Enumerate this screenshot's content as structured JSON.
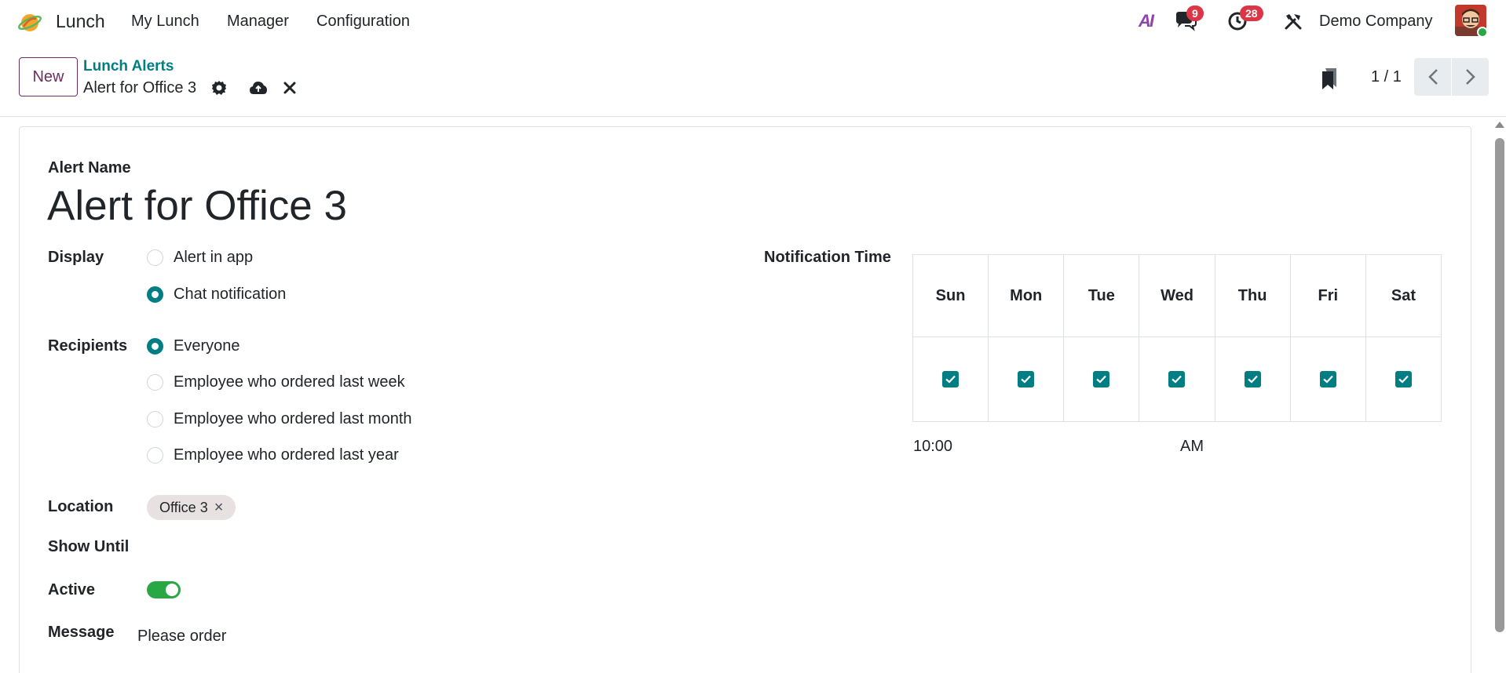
{
  "navbar": {
    "app_name": "Lunch",
    "menu": [
      "My Lunch",
      "Manager",
      "Configuration"
    ],
    "messages_count": "9",
    "activities_count": "28",
    "company": "Demo Company",
    "ai_label": "AI"
  },
  "control_panel": {
    "new_label": "New",
    "breadcrumb_parent": "Lunch Alerts",
    "breadcrumb_current": "Alert for Office 3",
    "pager": "1 / 1"
  },
  "form": {
    "name_label": "Alert Name",
    "name_value": "Alert for Office 3",
    "display_label": "Display",
    "display_options": [
      {
        "label": "Alert in app",
        "checked": false
      },
      {
        "label": "Chat notification",
        "checked": true
      }
    ],
    "recipients_label": "Recipients",
    "recipients_options": [
      {
        "label": "Everyone",
        "checked": true
      },
      {
        "label": "Employee who ordered last week",
        "checked": false
      },
      {
        "label": "Employee who ordered last month",
        "checked": false
      },
      {
        "label": "Employee who ordered last year",
        "checked": false
      }
    ],
    "location_label": "Location",
    "location_tag": "Office 3",
    "show_until_label": "Show Until",
    "active_label": "Active",
    "active": true,
    "message_label": "Message",
    "message_value": "Please order",
    "notification_time_label": "Notification Time",
    "days": [
      {
        "name": "Sun",
        "checked": true
      },
      {
        "name": "Mon",
        "checked": true
      },
      {
        "name": "Tue",
        "checked": true
      },
      {
        "name": "Wed",
        "checked": true
      },
      {
        "name": "Thu",
        "checked": true
      },
      {
        "name": "Fri",
        "checked": true
      },
      {
        "name": "Sat",
        "checked": true
      }
    ],
    "time_value": "10:00",
    "time_period": "AM"
  },
  "colors": {
    "primary_teal": "#017e84",
    "brand_purple": "#6c2d62",
    "badge_red": "#dc3545",
    "toggle_green": "#28a745"
  }
}
